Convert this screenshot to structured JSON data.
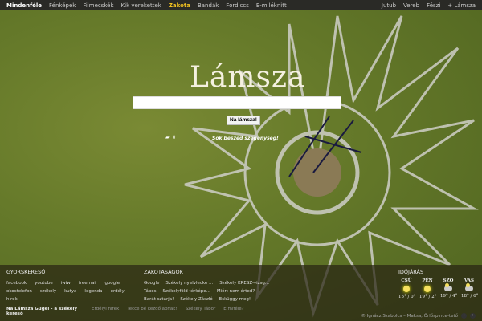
{
  "topnav": {
    "left": [
      "Mindenféle",
      "Fénképek",
      "Filmecskék",
      "Kik verekettek",
      "Zakota",
      "Bandák",
      "Fordiccs",
      "E-miléknitt"
    ],
    "right": [
      "Jutub",
      "Vereb",
      "Fészi",
      "+ Lámsza"
    ]
  },
  "logo": "Lámsza",
  "search": {
    "value": "",
    "button": "Na lámsza!"
  },
  "counter": "0",
  "slogan": "Sok beszéd szegénység!",
  "footer": {
    "quick": {
      "title": "GYORSKERESŐ",
      "links": [
        "facebook",
        "youtube",
        "iwiw",
        "freemail",
        "google",
        "okostelefon",
        "székely",
        "kutya",
        "legenda",
        "erdély",
        "hírek"
      ]
    },
    "zakota": {
      "title": "ZAKOTASÁGOK",
      "links": [
        "Google",
        "Székely nyelvlecke ...",
        "Székely KRESZ-vizsg...",
        "Tápos",
        "Székelyföld térképe...",
        "Miért nem érted?",
        "Barát sztárja!",
        "Székely Zászló",
        "Esküggy meg!"
      ]
    },
    "bottom": {
      "tagline": "Na Lámsza Gugel - a székely kereső",
      "links": [
        "Erdélyi hírek",
        "Tecce bé kezdőlapnak!",
        "Székely Tábor",
        "E miféle?"
      ]
    },
    "weather": {
      "title": "IDŐJÁRÁS",
      "days": [
        {
          "name": "CSÜ",
          "icon": "sun",
          "temp": "15° / 0°"
        },
        {
          "name": "PÉN",
          "icon": "sun",
          "temp": "19° / 2°"
        },
        {
          "name": "SZO",
          "icon": "partly-cloudy",
          "temp": "19° / 4°"
        },
        {
          "name": "VAS",
          "icon": "partly-cloudy",
          "temp": "18° / 6°"
        }
      ]
    },
    "credit": "© Ignácz Szabolcs – Maksa, Őrlőspince-tető"
  }
}
